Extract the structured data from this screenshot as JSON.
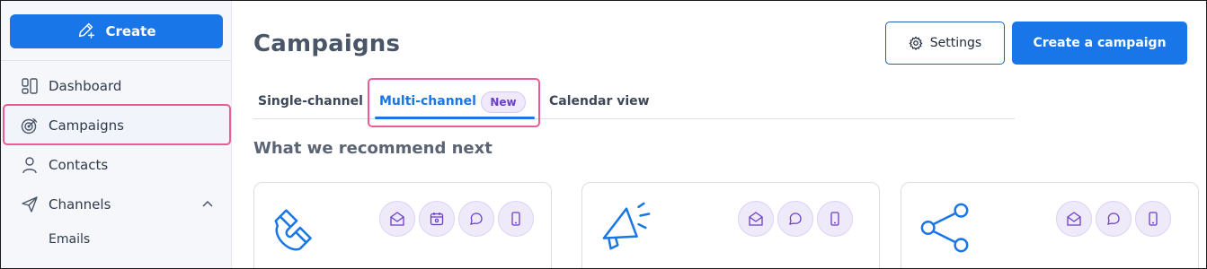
{
  "sidebar": {
    "create_label": "Create",
    "items": [
      {
        "label": "Dashboard",
        "icon": "dashboard-icon"
      },
      {
        "label": "Campaigns",
        "icon": "target-icon",
        "active": true
      },
      {
        "label": "Contacts",
        "icon": "person-icon"
      },
      {
        "label": "Channels",
        "icon": "send-icon",
        "expanded": true
      }
    ],
    "subitems": [
      {
        "label": "Emails"
      }
    ]
  },
  "header": {
    "title": "Campaigns",
    "settings_label": "Settings",
    "create_campaign_label": "Create a campaign"
  },
  "tabs": [
    {
      "label": "Single-channel"
    },
    {
      "label": "Multi-channel",
      "badge": "New",
      "active": true
    },
    {
      "label": "Calendar view"
    }
  ],
  "section": {
    "title": "What we recommend next"
  },
  "cards": [
    {
      "icon": "magnet-icon",
      "channels": [
        "email-icon",
        "calendar-icon",
        "chat-icon",
        "mobile-icon"
      ]
    },
    {
      "icon": "megaphone-icon",
      "channels": [
        "email-icon",
        "chat-icon",
        "mobile-icon"
      ]
    },
    {
      "icon": "share-icon",
      "channels": [
        "email-icon",
        "chat-icon",
        "mobile-icon"
      ]
    }
  ],
  "colors": {
    "primary": "#1976e8",
    "highlight": "#ec5b93",
    "chip_bg": "#efeaf9",
    "chip_icon": "#6b3fc4"
  }
}
